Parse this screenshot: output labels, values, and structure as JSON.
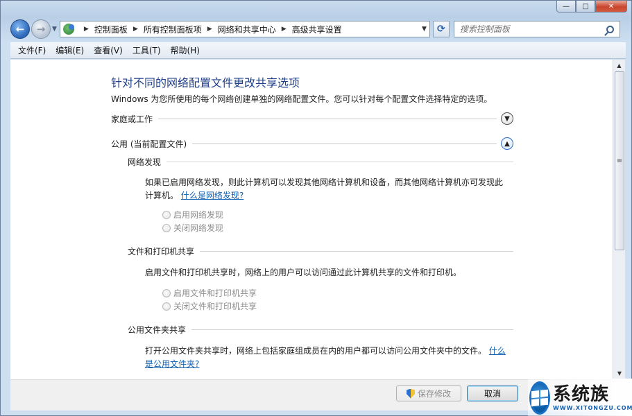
{
  "window": {
    "controls": {
      "minimize": "—",
      "maximize": "□",
      "close": "✕"
    }
  },
  "nav": {
    "breadcrumbs": [
      "控制面板",
      "所有控制面板项",
      "网络和共享中心",
      "高级共享设置"
    ],
    "search_placeholder": "搜索控制面板"
  },
  "menu": {
    "items": [
      "文件(F)",
      "编辑(E)",
      "查看(V)",
      "工具(T)",
      "帮助(H)"
    ]
  },
  "main": {
    "heading": "针对不同的网络配置文件更改共享选项",
    "description": "Windows 为您所使用的每个网络创建单独的网络配置文件。您可以针对每个配置文件选择特定的选项。",
    "profiles": [
      {
        "label": "家庭或工作",
        "expanded": false
      },
      {
        "label": "公用 (当前配置文件)",
        "expanded": true
      }
    ],
    "network_discovery": {
      "title": "网络发现",
      "text_line1": "如果已启用网络发现，则此计算机可以发现其他网络计算机和设备，而其他网络计算机亦可发现此",
      "text_line2": "计算机。",
      "link": "什么是网络发现?",
      "options": [
        "启用网络发现",
        "关闭网络发现"
      ]
    },
    "file_printer_sharing": {
      "title": "文件和打印机共享",
      "text": "启用文件和打印机共享时，网络上的用户可以访问通过此计算机共享的文件和打印机。",
      "options": [
        "启用文件和打印机共享",
        "关闭文件和打印机共享"
      ]
    },
    "public_folder_sharing": {
      "title": "公用文件夹共享",
      "text": "打开公用文件夹共享时，网络上包括家庭组成员在内的用户都可以访问公用文件夹中的文件。",
      "link_part1": "什么",
      "link_part2": "是公用文件夹?"
    }
  },
  "buttons": {
    "save": "保存修改",
    "cancel": "取消"
  },
  "watermark": {
    "name": "系统族",
    "url": "WWW.XITONGZU.COM"
  }
}
